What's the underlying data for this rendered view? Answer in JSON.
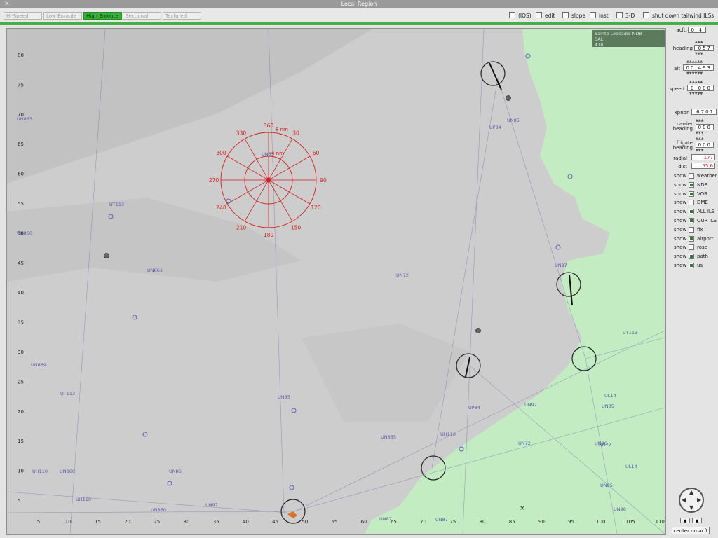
{
  "window": {
    "title": "Local Region",
    "close_glyph": "✕"
  },
  "toolbar": {
    "tabs": [
      {
        "label": "Hi-Speed",
        "active": false
      },
      {
        "label": "Low Enroute",
        "active": false
      },
      {
        "label": "High Enroute",
        "active": true
      },
      {
        "label": "Sectional",
        "active": false
      },
      {
        "label": "Textured",
        "active": false
      }
    ],
    "checks": [
      {
        "label": "(IOS)",
        "checked": false
      },
      {
        "label": "edit",
        "checked": false
      },
      {
        "label": "slope",
        "checked": false
      },
      {
        "label": "inst",
        "checked": false
      },
      {
        "label": "3-D",
        "checked": false
      },
      {
        "label": "shut down tailwind ILSs",
        "checked": false
      }
    ]
  },
  "info": {
    "line1": "Sainte Leocadie NDB",
    "line2": "SAL",
    "line3": "418"
  },
  "panel": {
    "acft_label": "acft:",
    "acft_value": "0",
    "heading_label": "heading",
    "heading_value": "057",
    "alt_label": "alt",
    "alt_value": "00,493",
    "speed_label": "speed",
    "speed_value": "0,000",
    "xpndr_label": "xpndr",
    "xpndr_value": "6701",
    "carrier_label_1": "carrier",
    "carrier_label_2": "heading",
    "carrier_value": "000",
    "frigate_label_1": "frigate",
    "frigate_label_2": "heading",
    "frigate_value": "000",
    "radial_label": "radial",
    "radial_value": "177",
    "dist_label": "dist",
    "dist_value": "55.6",
    "shows": [
      {
        "prefix": "show",
        "name": "weather",
        "checked": false
      },
      {
        "prefix": "show",
        "name": "NDB",
        "checked": true
      },
      {
        "prefix": "show",
        "name": "VOR",
        "checked": true
      },
      {
        "prefix": "show",
        "name": "DME",
        "checked": false
      },
      {
        "prefix": "show",
        "name": "ALL ILS",
        "checked": true
      },
      {
        "prefix": "show",
        "name": "OUR ILS",
        "checked": true
      },
      {
        "prefix": "show",
        "name": "fix",
        "checked": false
      },
      {
        "prefix": "show",
        "name": "airport",
        "checked": true
      },
      {
        "prefix": "show",
        "name": "rose",
        "checked": false
      },
      {
        "prefix": "show",
        "name": "path",
        "checked": true
      },
      {
        "prefix": "show",
        "name": "us",
        "checked": true
      }
    ],
    "center_label": "center on acft"
  },
  "map": {
    "colors": {
      "terrain": "#cdcdcd",
      "sea": "#c3ecc3",
      "rose": "#d42020",
      "airway": "#6a6aa8"
    },
    "x_ticks": [
      "5",
      "10",
      "15",
      "20",
      "25",
      "30",
      "35",
      "40",
      "45",
      "50",
      "55",
      "60",
      "65",
      "70",
      "75",
      "80",
      "85",
      "90",
      "95",
      "100",
      "105",
      "110"
    ],
    "y_ticks": [
      "80",
      "75",
      "70",
      "65",
      "60",
      "55",
      "50",
      "45",
      "40",
      "35",
      "30",
      "25",
      "20",
      "15",
      "10",
      "5"
    ],
    "rose": {
      "ring_labels": [
        "8 nm",
        "4 nm"
      ],
      "bearings": [
        "360",
        "30",
        "60",
        "90",
        "120",
        "150",
        "180",
        "210",
        "240",
        "270",
        "300",
        "330"
      ]
    },
    "airway_labels": [
      "UN863",
      "UN860",
      "UT113",
      "UN861",
      "UN72",
      "UN85",
      "UP84",
      "UN85",
      "UN97",
      "UN869",
      "UT113",
      "UN85",
      "UP84",
      "UN97",
      "UN85",
      "UL14",
      "UN860",
      "UN86",
      "UH110",
      "UT113",
      "UL14",
      "UN72",
      "UN87",
      "UN85",
      "UN86",
      "UH110",
      "UN860",
      "UH110",
      "UN97",
      "UN87",
      "UN98",
      "UN72",
      "UN855"
    ]
  }
}
